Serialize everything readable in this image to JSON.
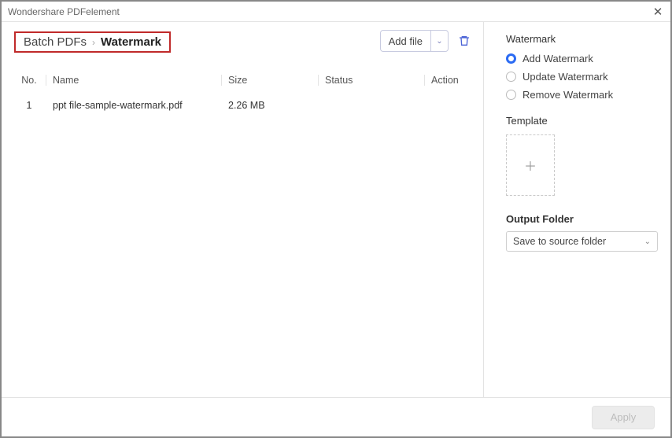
{
  "window": {
    "title": "Wondershare PDFelement"
  },
  "breadcrumb": {
    "root": "Batch PDFs",
    "current": "Watermark"
  },
  "toolbar": {
    "add_file": "Add file"
  },
  "table": {
    "headers": {
      "no": "No.",
      "name": "Name",
      "size": "Size",
      "status": "Status",
      "action": "Action"
    },
    "rows": [
      {
        "no": "1",
        "name": "ppt file-sample-watermark.pdf",
        "size": "2.26 MB",
        "status": "",
        "action": ""
      }
    ]
  },
  "sidebar": {
    "title": "Watermark",
    "options": [
      {
        "label": "Add Watermark",
        "selected": true
      },
      {
        "label": "Update Watermark",
        "selected": false
      },
      {
        "label": "Remove Watermark",
        "selected": false
      }
    ],
    "template_label": "Template",
    "output_label": "Output Folder",
    "output_value": "Save to source folder"
  },
  "footer": {
    "apply": "Apply"
  }
}
